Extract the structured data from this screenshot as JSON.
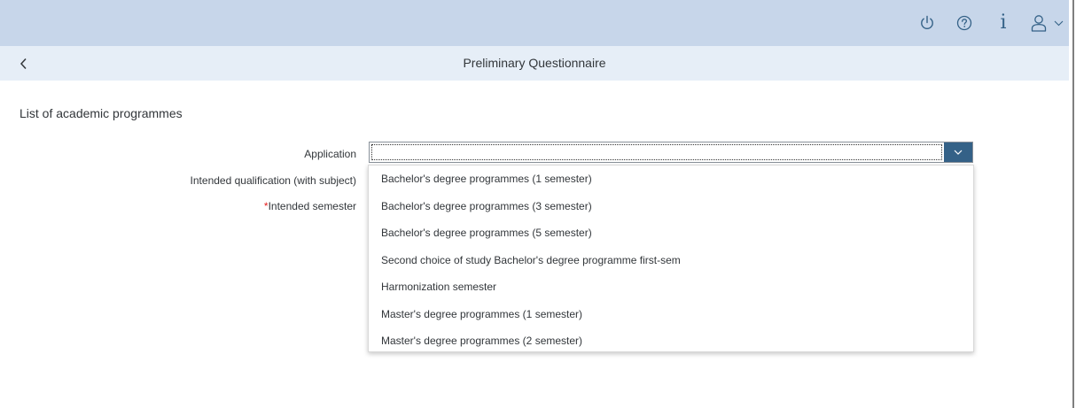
{
  "header": {
    "icons": [
      "power-icon",
      "help-icon",
      "info-icon",
      "user-icon",
      "chevron-down-icon"
    ],
    "info_glyph": "i",
    "color": "#c7d6ea",
    "icon_color": "#346187"
  },
  "subheader": {
    "title": "Preliminary Questionnaire",
    "back_icon": "back-icon"
  },
  "main": {
    "section_title": "List of academic programmes",
    "fields": {
      "application": {
        "label": "Application",
        "value": ""
      },
      "intended_qualification": {
        "label": "Intended qualification (with subject)"
      },
      "intended_semester": {
        "label": "Intended semester",
        "required_marker": "*"
      }
    }
  },
  "dropdown": {
    "options": [
      "Bachelor's degree programmes (1 semester)",
      "Bachelor's degree programmes (3 semester)",
      "Bachelor's degree programmes (5 semester)",
      "Second choice of study Bachelor's degree programme first-sem",
      "Harmonization semester",
      "Master's degree programmes (1 semester)",
      "Master's degree programmes (2 semester)"
    ],
    "arrow_color": "#346187"
  }
}
